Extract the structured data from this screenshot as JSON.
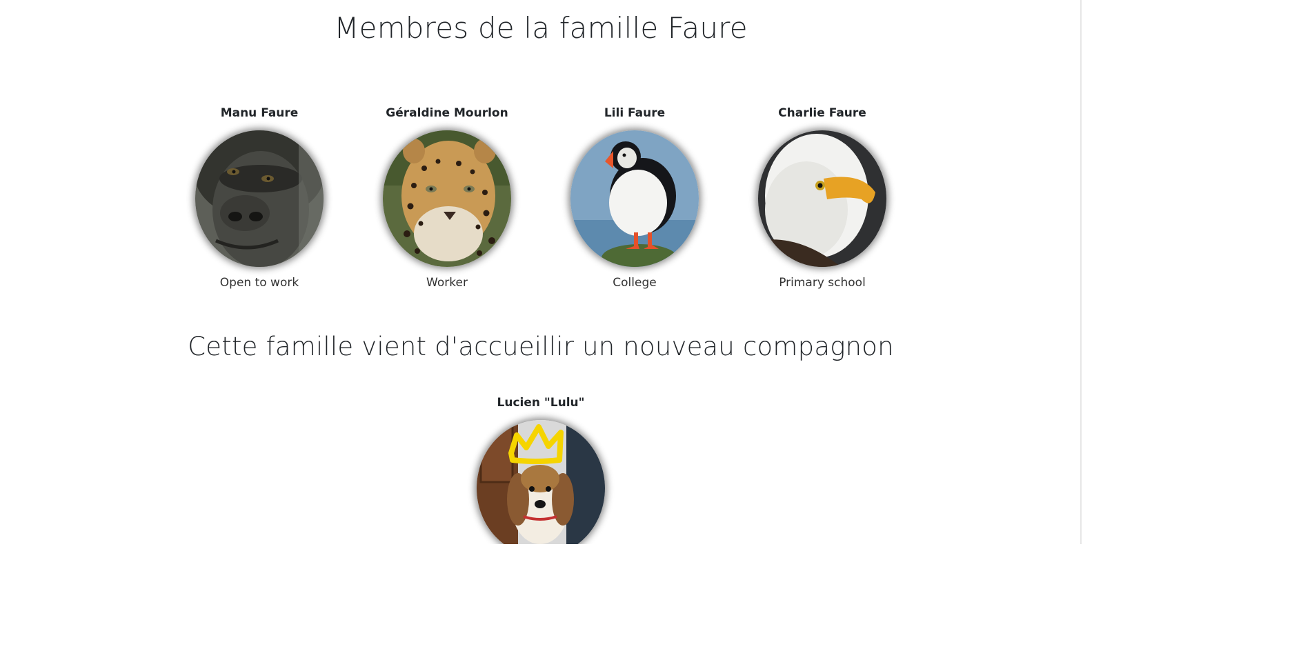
{
  "page": {
    "title": "Membres de la famille Faure"
  },
  "family": {
    "members": [
      {
        "name": "Manu Faure",
        "status": "Open to work",
        "photo": "gorilla-photo"
      },
      {
        "name": "Géraldine Mourlon",
        "status": "Worker",
        "photo": "leopard-photo"
      },
      {
        "name": "Lili Faure",
        "status": "College",
        "photo": "puffin-photo"
      },
      {
        "name": "Charlie Faure",
        "status": "Primary school",
        "photo": "eagle-photo"
      }
    ]
  },
  "companion_section": {
    "title": "Cette famille vient d'accueillir un nouveau compagnon",
    "companion": {
      "name": "Lucien \"Lulu\"",
      "photo": "beagle-with-crown-photo"
    }
  },
  "colors": {
    "text": "#212529",
    "background": "#ffffff",
    "crown": "#f5d400"
  }
}
